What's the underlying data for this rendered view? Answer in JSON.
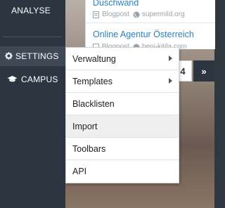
{
  "sidebar": {
    "analyse_label": "ANALYSE",
    "settings_label": "SETTINGS",
    "campus_label": "CAMPUS"
  },
  "results": [
    {
      "title": "Duschwand",
      "type": "Blogpost",
      "domain": "supermild.org"
    },
    {
      "title": "Online Agentur Österreich",
      "type": "Blogpost",
      "domain": "beni-kitila.com"
    }
  ],
  "pagination": {
    "current": "4",
    "next": "»"
  },
  "settings_menu": {
    "items": [
      {
        "label": "Verwaltung",
        "has_submenu": true
      },
      {
        "label": "Templates",
        "has_submenu": true
      },
      {
        "label": "Blacklisten",
        "has_submenu": false
      },
      {
        "label": "Import",
        "has_submenu": false
      },
      {
        "label": "Toolbars",
        "has_submenu": false
      },
      {
        "label": "API",
        "has_submenu": false
      }
    ]
  },
  "colors": {
    "sidebar_bg": "#2d3540",
    "link_blue": "#2a7fc1",
    "menu_hover": "#efefef"
  }
}
